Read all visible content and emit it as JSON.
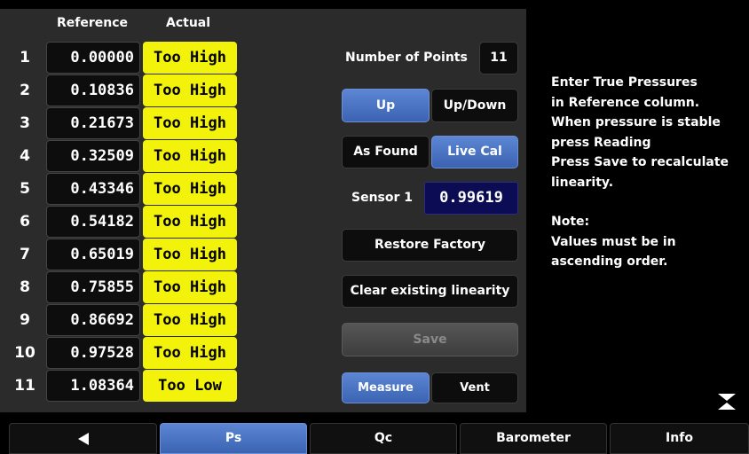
{
  "table": {
    "ref_header": "Reference",
    "act_header": "Actual",
    "rows": [
      {
        "num": "1",
        "ref": "0.00000",
        "act": "Too High"
      },
      {
        "num": "2",
        "ref": "0.10836",
        "act": "Too High"
      },
      {
        "num": "3",
        "ref": "0.21673",
        "act": "Too High"
      },
      {
        "num": "4",
        "ref": "0.32509",
        "act": "Too High"
      },
      {
        "num": "5",
        "ref": "0.43346",
        "act": "Too High"
      },
      {
        "num": "6",
        "ref": "0.54182",
        "act": "Too High"
      },
      {
        "num": "7",
        "ref": "0.65019",
        "act": "Too High"
      },
      {
        "num": "8",
        "ref": "0.75855",
        "act": "Too High"
      },
      {
        "num": "9",
        "ref": "0.86692",
        "act": "Too High"
      },
      {
        "num": "10",
        "ref": "0.97528",
        "act": "Too High"
      },
      {
        "num": "11",
        "ref": "1.08364",
        "act": "Too Low"
      }
    ]
  },
  "controls": {
    "points_label": "Number of Points",
    "points_value": "11",
    "up": "Up",
    "updown": "Up/Down",
    "as_found": "As Found",
    "live_cal": "Live Cal",
    "sensor_label": "Sensor 1",
    "sensor_value": "0.99619",
    "restore": "Restore Factory",
    "clear": "Clear existing linearity",
    "save": "Save",
    "measure": "Measure",
    "vent": "Vent"
  },
  "info": {
    "lines1": [
      "Enter True Pressures",
      "in Reference column.",
      "When pressure is stable",
      "press Reading",
      "Press Save to recalculate",
      "linearity."
    ],
    "lines2": [
      "Note:",
      "Values must be in",
      "ascending order."
    ]
  },
  "tabs": {
    "ps": "Ps",
    "qc": "Qc",
    "barometer": "Barometer",
    "info": "Info"
  },
  "colors": {
    "accent_blue": "#4a74c6",
    "warning_yellow": "#f2f20a",
    "sensor_bg": "#0c0c55"
  },
  "icons": {
    "back": "back-arrow-icon",
    "collapse": "collapse-icon"
  }
}
